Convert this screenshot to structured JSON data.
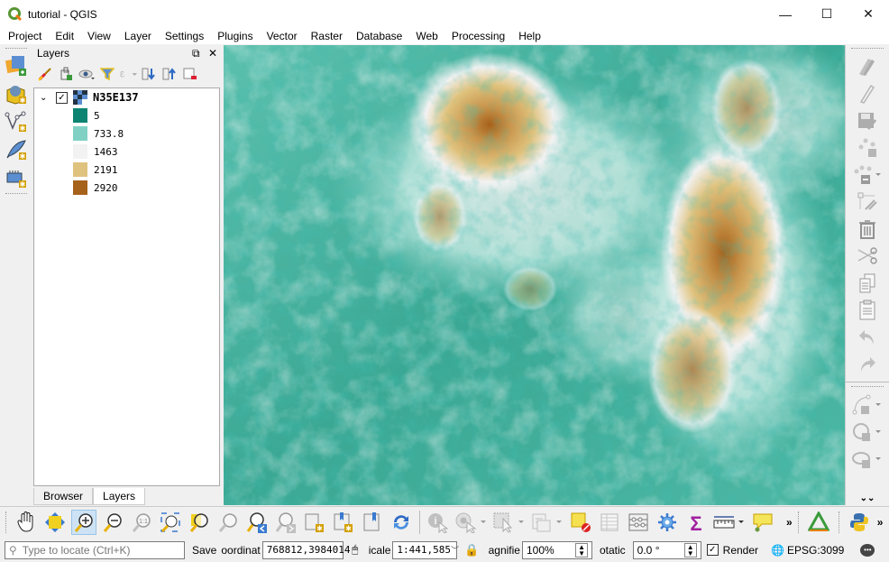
{
  "window": {
    "title": "tutorial - QGIS",
    "controls": {
      "minimize": "—",
      "maximize": "☐",
      "close": "✕"
    }
  },
  "menu": [
    "Project",
    "Edit",
    "View",
    "Layer",
    "Settings",
    "Plugins",
    "Vector",
    "Raster",
    "Database",
    "Web",
    "Processing",
    "Help"
  ],
  "layers_panel": {
    "title": "Layers",
    "float_icon": "⧉",
    "close_icon": "✕",
    "tools": [
      "style-manager-icon",
      "add-group-icon",
      "visibility-icon",
      "filter-icon",
      "expression-filter-icon",
      "expand-all-icon",
      "collapse-all-icon",
      "remove-layer-icon"
    ],
    "layer": {
      "name": "N35E137",
      "checked": true,
      "expanded": true,
      "legend": [
        {
          "label": "5",
          "color": "#0d8471"
        },
        {
          "label": "733.8",
          "color": "#80d1c4"
        },
        {
          "label": "1463",
          "color": "#f2f2f2"
        },
        {
          "label": "2191",
          "color": "#dfc27d"
        },
        {
          "label": "2920",
          "color": "#a6611a"
        }
      ]
    },
    "tabs": [
      {
        "label": "Browser",
        "active": false
      },
      {
        "label": "Layers",
        "active": true
      }
    ]
  },
  "left_toolbar": [
    "data-source-manager-icon",
    "new-geopackage-icon",
    "new-shapefile-icon",
    "new-spatialite-icon",
    "new-virtual-layer-icon"
  ],
  "right_toolbar": [
    "toggle-editing-icon",
    "current-edits-icon",
    "save-edits-icon",
    "add-feature-icon",
    "move-feature-icon",
    "vertex-tool-icon",
    "delete-icon",
    "cut-icon",
    "copy-icon",
    "paste-icon",
    "undo-icon",
    "redo-icon",
    "digitize-curve-icon",
    "circle-icon",
    "ellipse-icon"
  ],
  "map_toolbar": {
    "active_tool": "zoom-in",
    "overflow": "»"
  },
  "statusbar": {
    "locate_placeholder": "Type to locate (Ctrl+K)",
    "save_label": "Save",
    "coordinate_label": "oordinat",
    "coordinate_value": "768812,3984014",
    "scale_label": "icale",
    "scale_value": "1:441,585",
    "magnifier_label": "agnifie",
    "magnifier_value": "100%",
    "rotation_label": "otatic",
    "rotation_value": "0.0 °",
    "render_label": "Render",
    "render_checked": true,
    "crs": "EPSG:3099"
  }
}
